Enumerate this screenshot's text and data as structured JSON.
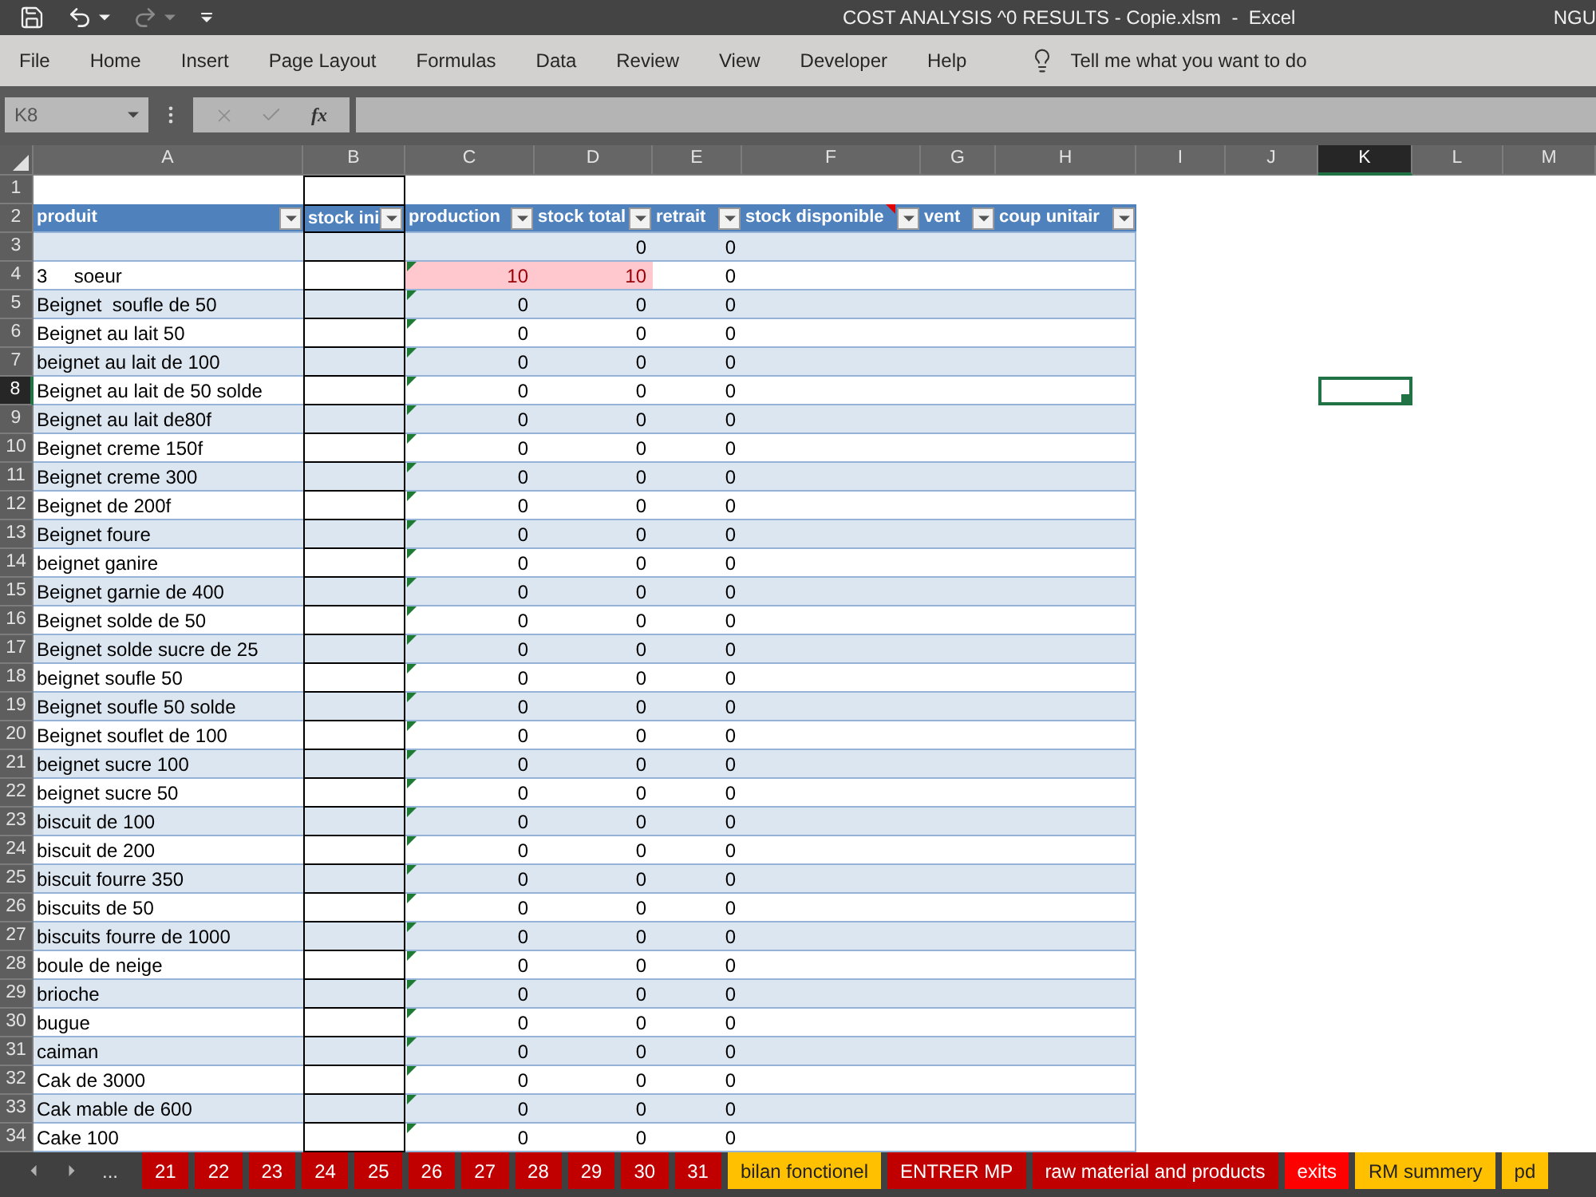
{
  "title_bar": {
    "title": "COST ANALYSIS ^0 RESULTS - Copie.xlsm  -  Excel",
    "user": "NGU"
  },
  "quick_access": [
    {
      "kind": "save",
      "disabled": false
    },
    {
      "kind": "undo",
      "disabled": false
    },
    {
      "kind": "redo",
      "disabled": true
    },
    {
      "kind": "customize",
      "disabled": false
    }
  ],
  "menu": {
    "items": [
      "File",
      "Home",
      "Insert",
      "Page Layout",
      "Formulas",
      "Data",
      "Review",
      "View",
      "Developer",
      "Help"
    ],
    "tell_me": "Tell me what you want to do"
  },
  "formula_bar": {
    "name_box": "K8",
    "buttons": [
      {
        "kind": "cancel",
        "disabled": true
      },
      {
        "kind": "enter",
        "disabled": true
      },
      {
        "kind": "function",
        "label": "fx",
        "disabled": false
      }
    ]
  },
  "column_headers": [
    {
      "label": "A",
      "selected": false
    },
    {
      "label": "B",
      "selected": false
    },
    {
      "label": "C",
      "selected": false
    },
    {
      "label": "D",
      "selected": false
    },
    {
      "label": "E",
      "selected": false
    },
    {
      "label": "F",
      "selected": false
    },
    {
      "label": "G",
      "selected": false
    },
    {
      "label": "H",
      "selected": false
    },
    {
      "label": "I",
      "selected": false
    },
    {
      "label": "J",
      "selected": false
    },
    {
      "label": "K",
      "selected": true
    },
    {
      "label": "L",
      "selected": false
    },
    {
      "label": "M",
      "selected": false
    }
  ],
  "row_headers": [
    {
      "label": "1",
      "selected": false
    },
    {
      "label": "2",
      "selected": false
    },
    {
      "label": "3",
      "selected": false
    },
    {
      "label": "4",
      "selected": false
    },
    {
      "label": "5",
      "selected": false
    },
    {
      "label": "6",
      "selected": false
    },
    {
      "label": "7",
      "selected": false
    },
    {
      "label": "8",
      "selected": true
    },
    {
      "label": "9",
      "selected": false
    },
    {
      "label": "10",
      "selected": false
    },
    {
      "label": "11",
      "selected": false
    },
    {
      "label": "12",
      "selected": false
    },
    {
      "label": "13",
      "selected": false
    },
    {
      "label": "14",
      "selected": false
    },
    {
      "label": "15",
      "selected": false
    },
    {
      "label": "16",
      "selected": false
    },
    {
      "label": "17",
      "selected": false
    },
    {
      "label": "18",
      "selected": false
    },
    {
      "label": "19",
      "selected": false
    },
    {
      "label": "20",
      "selected": false
    },
    {
      "label": "21",
      "selected": false
    },
    {
      "label": "22",
      "selected": false
    },
    {
      "label": "23",
      "selected": false
    },
    {
      "label": "24",
      "selected": false
    },
    {
      "label": "25",
      "selected": false
    },
    {
      "label": "26",
      "selected": false
    },
    {
      "label": "27",
      "selected": false
    },
    {
      "label": "28",
      "selected": false
    },
    {
      "label": "29",
      "selected": false
    },
    {
      "label": "30",
      "selected": false
    },
    {
      "label": "31",
      "selected": false
    },
    {
      "label": "32",
      "selected": false
    },
    {
      "label": "33",
      "selected": false
    },
    {
      "label": "34",
      "selected": false
    }
  ],
  "table": {
    "columns": [
      {
        "label": "produit",
        "comment": false
      },
      {
        "label": "stock ini",
        "comment": false
      },
      {
        "label": "production",
        "comment": false
      },
      {
        "label": "stock total",
        "comment": false
      },
      {
        "label": "retrait",
        "comment": false
      },
      {
        "label": "stock disponible",
        "comment": true
      },
      {
        "label": "vent",
        "comment": false
      },
      {
        "label": "coup unitair",
        "comment": false
      }
    ],
    "rows": [
      {
        "cells": [
          null,
          null,
          null,
          "0",
          "0",
          null,
          null,
          null
        ],
        "flagged": false,
        "highlighted": false
      },
      {
        "cells": [
          "3     soeur",
          null,
          "10",
          "10",
          "0",
          null,
          null,
          null
        ],
        "flagged": true,
        "highlighted": true
      },
      {
        "cells": [
          "Beignet  soufle de 50",
          null,
          "0",
          "0",
          "0",
          null,
          null,
          null
        ],
        "flagged": true,
        "highlighted": false
      },
      {
        "cells": [
          "Beignet au lait 50",
          null,
          "0",
          "0",
          "0",
          null,
          null,
          null
        ],
        "flagged": true,
        "highlighted": false
      },
      {
        "cells": [
          "beignet au lait de 100",
          null,
          "0",
          "0",
          "0",
          null,
          null,
          null
        ],
        "flagged": true,
        "highlighted": false
      },
      {
        "cells": [
          "Beignet au lait de 50 solde",
          null,
          "0",
          "0",
          "0",
          null,
          null,
          null
        ],
        "flagged": true,
        "highlighted": false
      },
      {
        "cells": [
          "Beignet au lait de80f",
          null,
          "0",
          "0",
          "0",
          null,
          null,
          null
        ],
        "flagged": true,
        "highlighted": false
      },
      {
        "cells": [
          "Beignet creme 150f",
          null,
          "0",
          "0",
          "0",
          null,
          null,
          null
        ],
        "flagged": true,
        "highlighted": false
      },
      {
        "cells": [
          "Beignet creme 300",
          null,
          "0",
          "0",
          "0",
          null,
          null,
          null
        ],
        "flagged": true,
        "highlighted": false
      },
      {
        "cells": [
          "Beignet de 200f",
          null,
          "0",
          "0",
          "0",
          null,
          null,
          null
        ],
        "flagged": true,
        "highlighted": false
      },
      {
        "cells": [
          "Beignet foure",
          null,
          "0",
          "0",
          "0",
          null,
          null,
          null
        ],
        "flagged": true,
        "highlighted": false
      },
      {
        "cells": [
          "beignet ganire",
          null,
          "0",
          "0",
          "0",
          null,
          null,
          null
        ],
        "flagged": true,
        "highlighted": false
      },
      {
        "cells": [
          "Beignet garnie de 400",
          null,
          "0",
          "0",
          "0",
          null,
          null,
          null
        ],
        "flagged": true,
        "highlighted": false
      },
      {
        "cells": [
          "Beignet solde de 50",
          null,
          "0",
          "0",
          "0",
          null,
          null,
          null
        ],
        "flagged": true,
        "highlighted": false
      },
      {
        "cells": [
          "Beignet solde sucre de 25",
          null,
          "0",
          "0",
          "0",
          null,
          null,
          null
        ],
        "flagged": true,
        "highlighted": false
      },
      {
        "cells": [
          "beignet soufle 50",
          null,
          "0",
          "0",
          "0",
          null,
          null,
          null
        ],
        "flagged": true,
        "highlighted": false
      },
      {
        "cells": [
          "Beignet soufle 50 solde",
          null,
          "0",
          "0",
          "0",
          null,
          null,
          null
        ],
        "flagged": true,
        "highlighted": false
      },
      {
        "cells": [
          "Beignet souflet de 100",
          null,
          "0",
          "0",
          "0",
          null,
          null,
          null
        ],
        "flagged": true,
        "highlighted": false
      },
      {
        "cells": [
          "beignet sucre 100",
          null,
          "0",
          "0",
          "0",
          null,
          null,
          null
        ],
        "flagged": true,
        "highlighted": false
      },
      {
        "cells": [
          "beignet sucre 50",
          null,
          "0",
          "0",
          "0",
          null,
          null,
          null
        ],
        "flagged": true,
        "highlighted": false
      },
      {
        "cells": [
          "biscuit de 100",
          null,
          "0",
          "0",
          "0",
          null,
          null,
          null
        ],
        "flagged": true,
        "highlighted": false
      },
      {
        "cells": [
          "biscuit de 200",
          null,
          "0",
          "0",
          "0",
          null,
          null,
          null
        ],
        "flagged": true,
        "highlighted": false
      },
      {
        "cells": [
          "biscuit fourre 350",
          null,
          "0",
          "0",
          "0",
          null,
          null,
          null
        ],
        "flagged": true,
        "highlighted": false
      },
      {
        "cells": [
          "biscuits de 50",
          null,
          "0",
          "0",
          "0",
          null,
          null,
          null
        ],
        "flagged": true,
        "highlighted": false
      },
      {
        "cells": [
          "biscuits fourre de 1000",
          null,
          "0",
          "0",
          "0",
          null,
          null,
          null
        ],
        "flagged": true,
        "highlighted": false
      },
      {
        "cells": [
          "boule de neige",
          null,
          "0",
          "0",
          "0",
          null,
          null,
          null
        ],
        "flagged": true,
        "highlighted": false
      },
      {
        "cells": [
          "brioche",
          null,
          "0",
          "0",
          "0",
          null,
          null,
          null
        ],
        "flagged": true,
        "highlighted": false
      },
      {
        "cells": [
          "bugue",
          null,
          "0",
          "0",
          "0",
          null,
          null,
          null
        ],
        "flagged": true,
        "highlighted": false
      },
      {
        "cells": [
          "caiman",
          null,
          "0",
          "0",
          "0",
          null,
          null,
          null
        ],
        "flagged": true,
        "highlighted": false
      },
      {
        "cells": [
          "Cak de 3000",
          null,
          "0",
          "0",
          "0",
          null,
          null,
          null
        ],
        "flagged": true,
        "highlighted": false
      },
      {
        "cells": [
          "Cak mable de 600",
          null,
          "0",
          "0",
          "0",
          null,
          null,
          null
        ],
        "flagged": true,
        "highlighted": false
      },
      {
        "cells": [
          "Cake 100",
          null,
          "0",
          "0",
          "0",
          null,
          null,
          null
        ],
        "flagged": true,
        "highlighted": false
      }
    ]
  },
  "sheet_nav": [
    {
      "kind": "prev"
    },
    {
      "kind": "next"
    },
    {
      "kind": "more",
      "label": "..."
    }
  ],
  "sheet_tabs": [
    {
      "label": "21",
      "color": "#c00000"
    },
    {
      "label": "22",
      "color": "#c00000"
    },
    {
      "label": "23",
      "color": "#c00000"
    },
    {
      "label": "24",
      "color": "#c00000"
    },
    {
      "label": "25",
      "color": "#c00000"
    },
    {
      "label": "26",
      "color": "#c00000"
    },
    {
      "label": "27",
      "color": "#c00000"
    },
    {
      "label": "28",
      "color": "#c00000"
    },
    {
      "label": "29",
      "color": "#c00000"
    },
    {
      "label": "30",
      "color": "#c00000"
    },
    {
      "label": "31",
      "color": "#c00000"
    },
    {
      "label": "bilan fonctionel",
      "color": "#ffc000"
    },
    {
      "label": "ENTRER MP",
      "color": "#c00000"
    },
    {
      "label": "raw material and products",
      "color": "#c00000"
    },
    {
      "label": "exits",
      "color": "#ff0000"
    },
    {
      "label": "RM summery",
      "color": "#ffc000"
    },
    {
      "label": "pd",
      "color": "#ffc000"
    }
  ]
}
